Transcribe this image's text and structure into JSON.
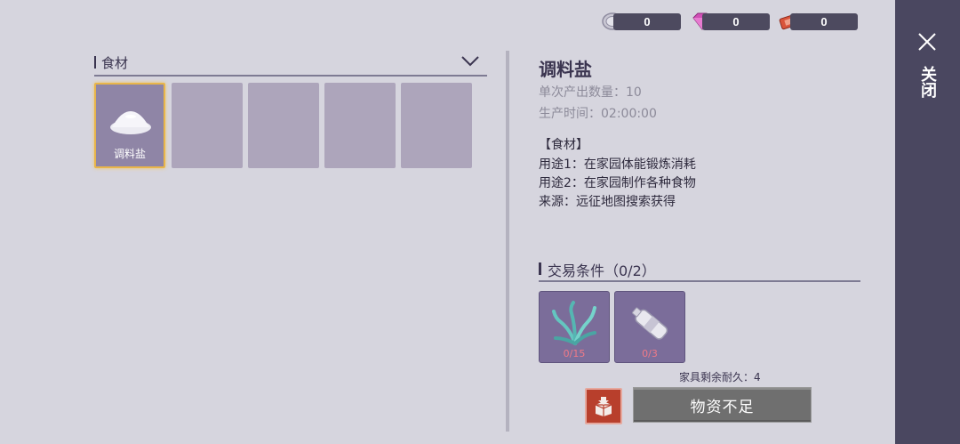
{
  "currencies": [
    {
      "icon": "coin-icon",
      "value": "0"
    },
    {
      "icon": "diamond-icon",
      "value": "0"
    },
    {
      "icon": "ticket-icon",
      "value": "0"
    }
  ],
  "inventory": {
    "category_label": "食材",
    "slots": [
      {
        "name": "调料盐",
        "selected": true
      },
      {
        "name": ""
      },
      {
        "name": ""
      },
      {
        "name": ""
      },
      {
        "name": ""
      }
    ]
  },
  "detail": {
    "title": "调料盐",
    "output_qty": "单次产出数量：10",
    "production_time": "生产时间：02:00:00",
    "category_tag": "【食材】",
    "use1": "用途1：在家园体能锻炼消耗",
    "use2": "用途2：在家园制作各种食物",
    "source": "来源：远征地图搜索获得"
  },
  "trade": {
    "header": "交易条件（0/2）",
    "requirements": [
      {
        "icon": "seaweed-icon",
        "count": "0/15"
      },
      {
        "icon": "water-bottle-icon",
        "count": "0/3"
      }
    ],
    "durability": "家具剩余耐久：4",
    "action_label": "物资不足"
  },
  "close_label": "关闭",
  "colors": {
    "background": "#d6d5de",
    "panel": "#4a4760",
    "selected_border": "#e8b54a",
    "counter_red": "#f07a87",
    "box_button": "#b83f2c"
  }
}
